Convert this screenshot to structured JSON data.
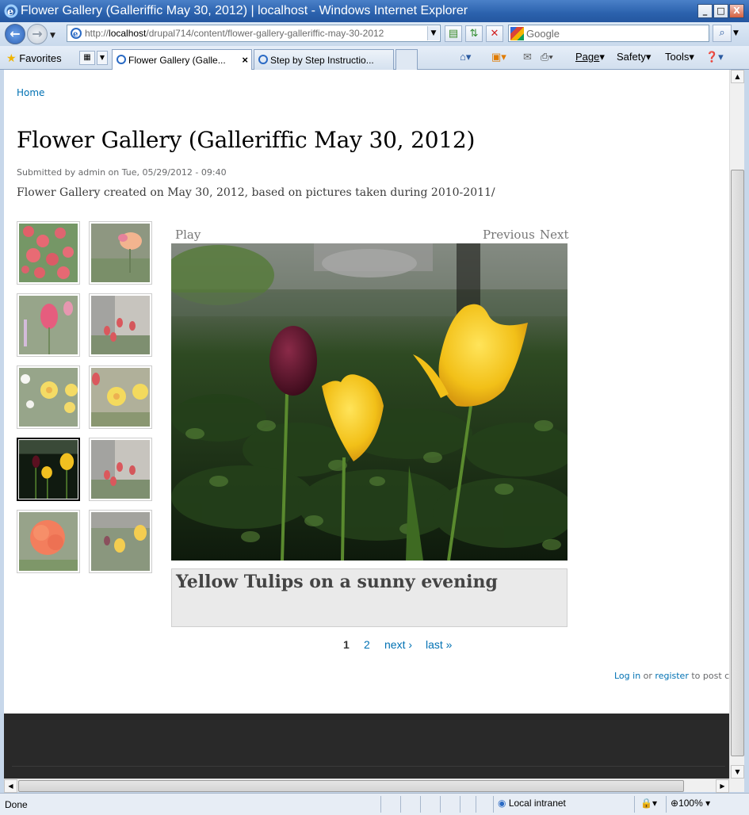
{
  "window": {
    "title": "Flower Gallery (Galleriffic May 30, 2012) | localhost - Windows Internet Explorer",
    "minimize": "_",
    "maximize": "□",
    "close": "X"
  },
  "addressbar": {
    "url_prefix": "http://",
    "url_host": "localhost",
    "url_path": "/drupal714/content/flower-gallery-galleriffic-may-30-2012",
    "search_placeholder": "Google"
  },
  "toolbar": {
    "favorites": "Favorites",
    "tabs": [
      {
        "label": "Flower Gallery (Galle..."
      },
      {
        "label": "Step by Step Instructio..."
      }
    ],
    "commands": [
      "Page",
      "Safety",
      "Tools"
    ]
  },
  "page": {
    "breadcrumb": "Home",
    "title": "Flower Gallery (Galleriffic May 30, 2012)",
    "submitted": "Submitted by admin on Tue, 05/29/2012 - 09:40",
    "body": "Flower Gallery created on May 30, 2012, based on pictures taken during 2010-2011/",
    "gallery": {
      "play": "Play",
      "previous": "Previous",
      "next": "Next",
      "caption": "Yellow Tulips on a sunny evening",
      "selected_index": 6,
      "thumbnail_count": 10
    },
    "pager": {
      "current": "1",
      "page2": "2",
      "next": "next ›",
      "last": "last »"
    },
    "login": {
      "login_link": "Log in",
      "or": " or ",
      "register_link": "register",
      "suffix": " to post comm"
    }
  },
  "statusbar": {
    "status": "Done",
    "zone": "Local intranet",
    "zoom": "100%"
  }
}
